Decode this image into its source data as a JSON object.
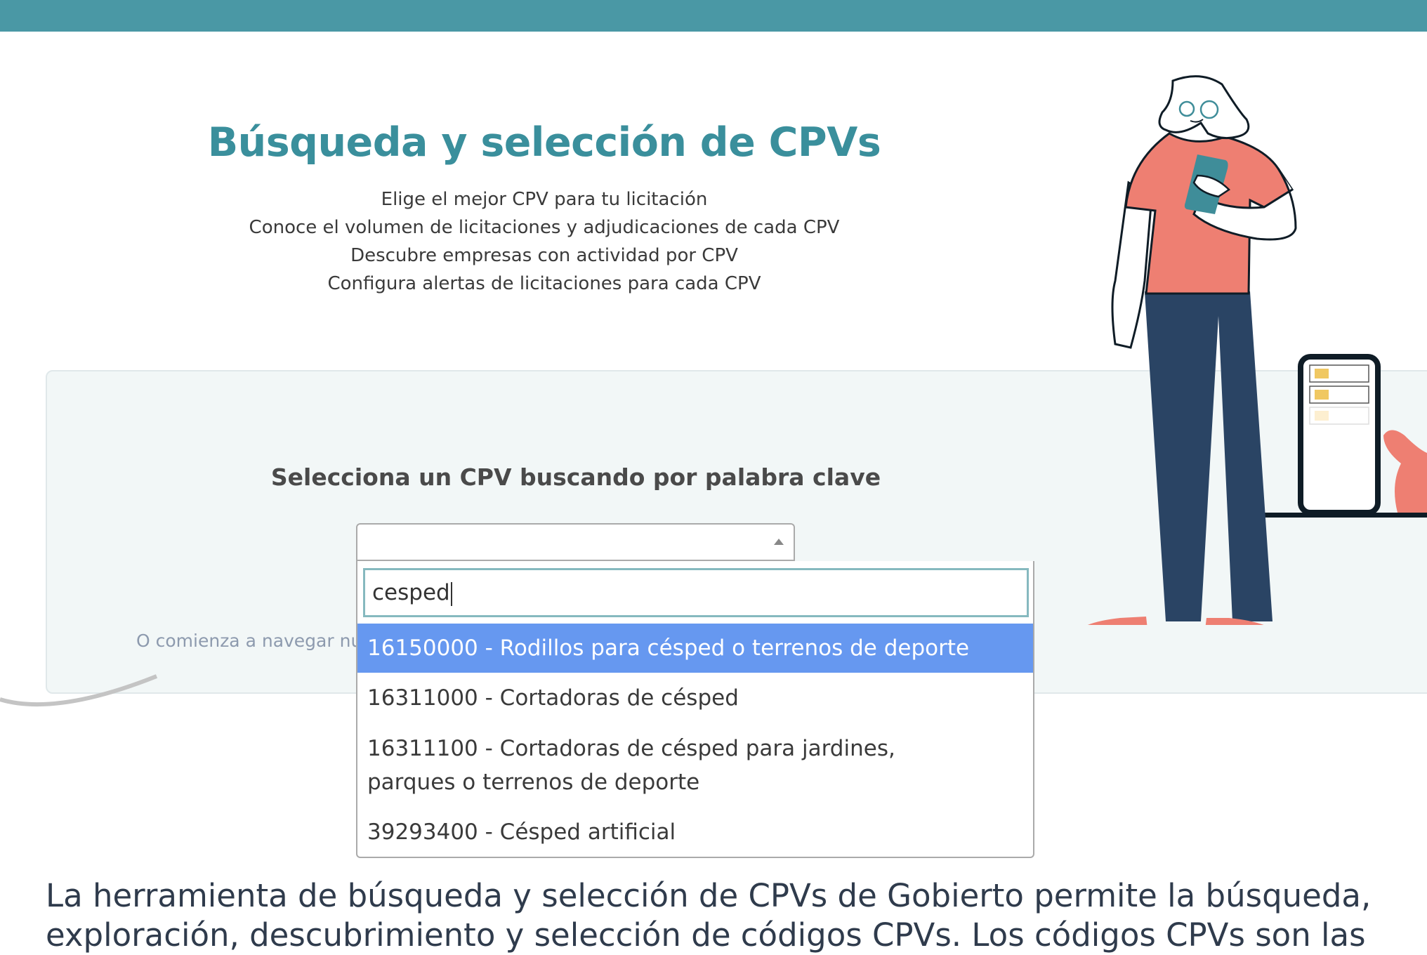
{
  "header": {
    "bar_color": "#4a98a5"
  },
  "hero": {
    "title": "Búsqueda y selección de CPVs",
    "subtitles": [
      "Elige el mejor CPV para tu licitación",
      "Conoce el volumen de licitaciones y adjudicaciones de cada CPV",
      "Descubre empresas con actividad por CPV",
      "Configura alertas de licitaciones para cada CPV"
    ]
  },
  "selector": {
    "heading": "Selecciona un CPV buscando por palabra clave",
    "select_value": "",
    "search_value": "cesped",
    "options": [
      {
        "label": "16150000 - Rodillos para césped o terrenos de deporte",
        "highlighted": true
      },
      {
        "label": "16311000 - Cortadoras de césped",
        "highlighted": false
      },
      {
        "label": "16311100 - Cortadoras de césped para jardines, parques o terrenos de deporte",
        "highlighted": false
      },
      {
        "label": "39293400 - Césped artificial",
        "highlighted": false
      }
    ],
    "browse_text": "O comienza a navegar nu",
    "highlight_color": "#6698f0"
  },
  "intro": {
    "text": "La herramienta de búsqueda y selección de CPVs de Gobierto permite la búsqueda, exploración, descubrimiento y selección de códigos CPVs. Los códigos CPVs son las"
  }
}
